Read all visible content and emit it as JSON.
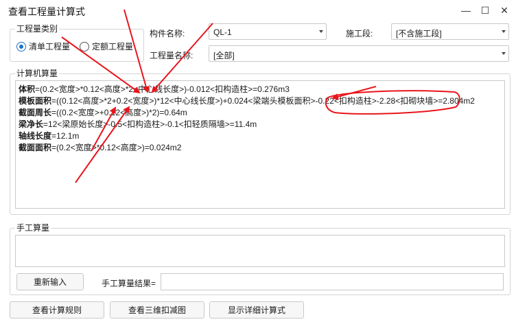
{
  "window": {
    "title": "查看工程量计算式",
    "min_glyph": "—",
    "max_glyph": "☐",
    "close_glyph": "✕"
  },
  "quantity_type": {
    "group_label": "工程量类别",
    "options": [
      {
        "label": "清单工程量",
        "checked": true
      },
      {
        "label": "定额工程量",
        "checked": false
      }
    ]
  },
  "filters": {
    "component_label": "构件名称:",
    "component_value": "QL-1",
    "stage_label": "施工段:",
    "stage_value": "[不含施工段]",
    "quantity_name_label": "工程量名称:",
    "quantity_name_value": "[全部]"
  },
  "computer_calc": {
    "group_label": "计算机算量",
    "lines": [
      {
        "key": "体积",
        "text": "=(0.2<宽度>*0.12<高度>*2<中心线长度>)-0.012<扣构造柱>=0.276m3"
      },
      {
        "key": "模板面积",
        "text": "=((0.12<高度>*2+0.2<宽度>)*12<中心线长度>)+0.024<梁端头模板面积>-0.22<扣构造柱>-2.28<扣砌块墙>=2.804m2"
      },
      {
        "key": "截面周长",
        "text": "=((0.2<宽度>+0.12<高度>)*2)=0.64m"
      },
      {
        "key": "梁净长",
        "text": "=12<梁原始长度>-0.5<扣构造柱>-0.1<扣轻质隔墙>=11.4m"
      },
      {
        "key": "轴线长度",
        "text": "=12.1m"
      },
      {
        "key": "截面面积",
        "text": "=(0.2<宽度>*0.12<高度>)=0.024m2"
      }
    ]
  },
  "manual_calc": {
    "group_label": "手工算量",
    "reenter_button": "重新输入",
    "result_label": "手工算量结果="
  },
  "footer": {
    "rules_button": "查看计算规则",
    "view3d_button": "查看三维扣减图",
    "detail_button": "显示详细计算式"
  },
  "colors": {
    "annotation_red": "#e8141b",
    "radio_accent": "#1a73c8"
  }
}
